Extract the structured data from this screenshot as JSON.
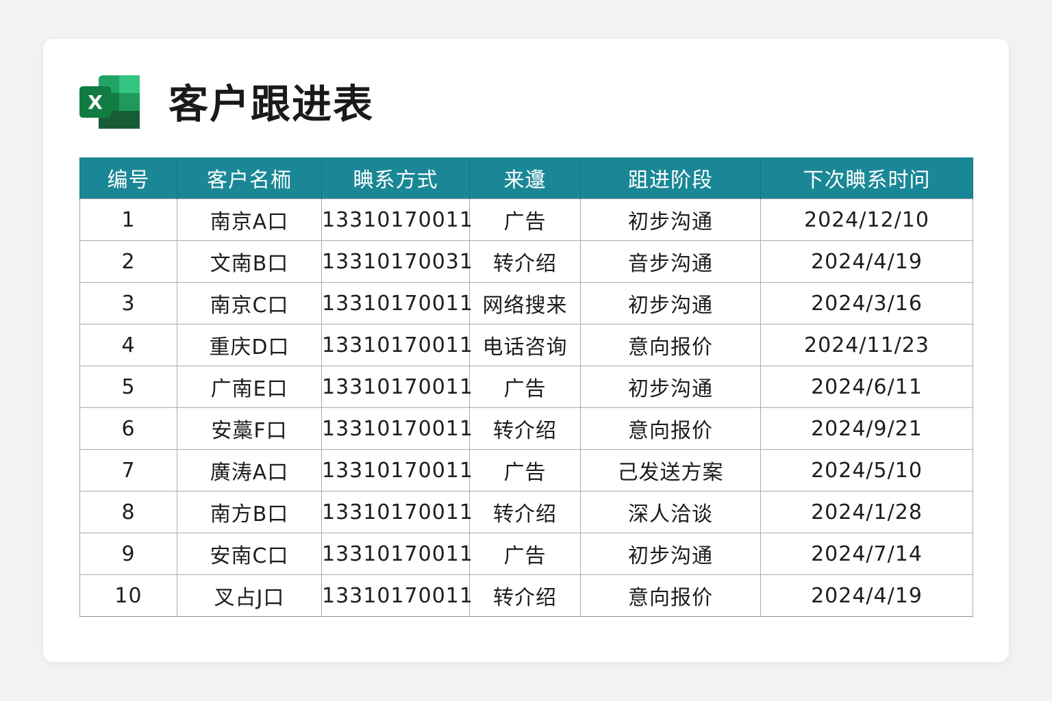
{
  "app": {
    "icon": "excel-icon",
    "icon_letter": "X",
    "brand_colors": [
      "#21a366",
      "#107c41",
      "#185c37",
      "#33c481"
    ]
  },
  "title": "客户跟进表",
  "colors": {
    "header_bg": "#1a8796",
    "header_text": "#ffffff",
    "border": "#a9a9a9",
    "text": "#1d1d1d"
  },
  "table": {
    "columns": [
      "编号",
      "客户名栭",
      "睓系方式",
      "来邍",
      "跙进阶段",
      "下次睓系时问"
    ],
    "rows": [
      [
        "1",
        "南京A口",
        "13310170011",
        "广告",
        "初步沟通",
        "2024/12/10"
      ],
      [
        "2",
        "文南B口",
        "13310170031",
        "转介绍",
        "音步沟通",
        "2024/4/19"
      ],
      [
        "3",
        "南京C口",
        "13310170011",
        "网络搜来",
        "初步沟通",
        "2024/3/16"
      ],
      [
        "4",
        "重庆D口",
        "13310170011",
        "电话咨询",
        "意向报价",
        "2024/11/23"
      ],
      [
        "5",
        "广南E口",
        "13310170011",
        "广告",
        "初步沟通",
        "2024/6/11"
      ],
      [
        "6",
        "安藁F口",
        "13310170011",
        "转介绍",
        "意向报价",
        "2024/9/21"
      ],
      [
        "7",
        "廣涛A口",
        "13310170011",
        "广告",
        "己发送方案",
        "2024/5/10"
      ],
      [
        "8",
        "南方B口",
        "13310170011",
        "转介绍",
        "深人洽谈",
        "2024/1/28"
      ],
      [
        "9",
        "安南C口",
        "13310170011",
        "广告",
        "初步沟通",
        "2024/7/14"
      ],
      [
        "10",
        "叉占J口",
        "13310170011",
        "转介绍",
        "意向报价",
        "2024/4/19"
      ]
    ]
  }
}
